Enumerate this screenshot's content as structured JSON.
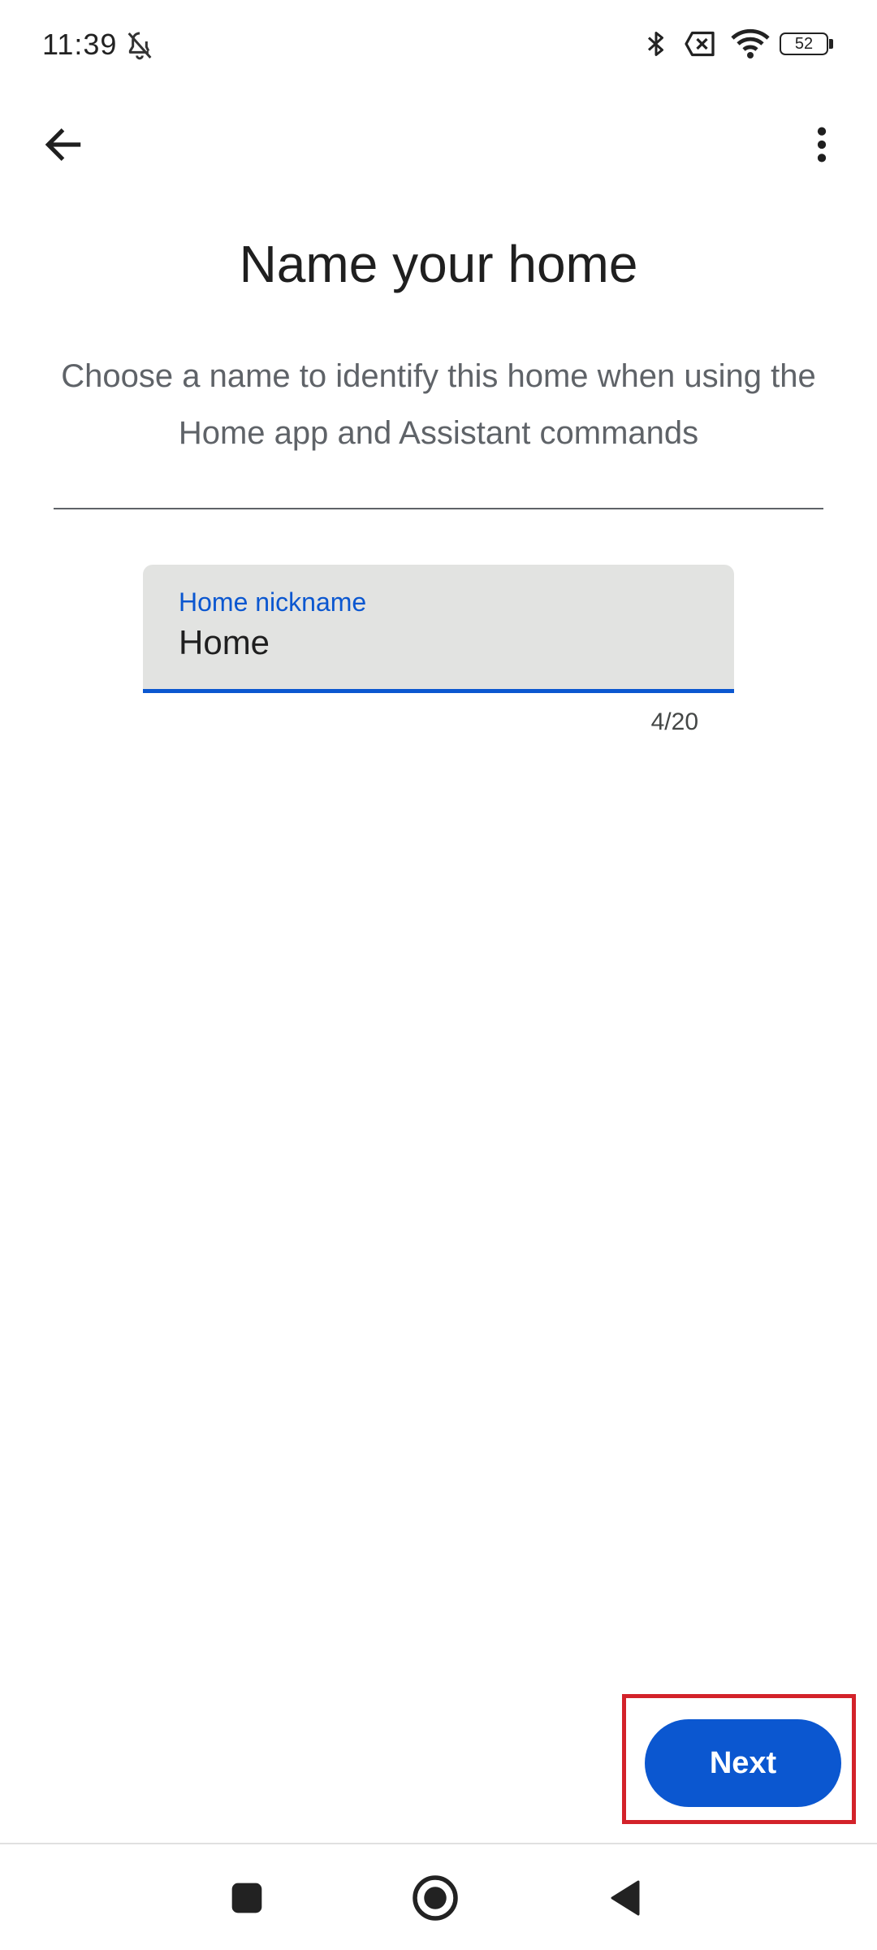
{
  "status_bar": {
    "time": "11:39",
    "battery": "52",
    "icons": [
      "bell-off-icon",
      "bluetooth-icon",
      "no-sim-icon",
      "wifi-icon",
      "battery-icon"
    ]
  },
  "app_bar": {
    "back_icon": "arrow-left-icon",
    "menu_icon": "more-vert-icon"
  },
  "main": {
    "title": "Name your home",
    "subtitle": "Choose a name to identify this home when using the Home app and Assistant commands",
    "field": {
      "label": "Home nickname",
      "value": "Home",
      "counter": "4/20"
    },
    "next_label": "Next"
  },
  "colors": {
    "accent": "#0b57d0",
    "field_bg": "#e2e3e1",
    "highlight": "#d3222a"
  },
  "nav_bar": {
    "icons": [
      "recents-square-icon",
      "home-circle-icon",
      "back-triangle-icon"
    ]
  }
}
